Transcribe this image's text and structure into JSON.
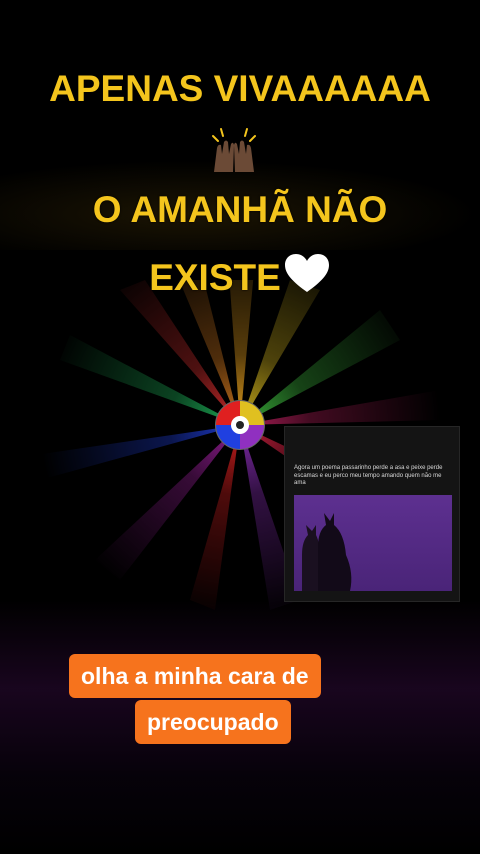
{
  "overlay": {
    "line1": "APENAS VIVAAAAAA",
    "line2": "O AMANHÃ NÃO",
    "line3": "EXISTE",
    "text_color": "#f4c51d"
  },
  "emoji": {
    "clap": "raising-hands-icon",
    "heart": "white-heart-icon"
  },
  "post": {
    "text": "Agora um poema passarinho perde a asa e peixe perde escamas e eu perco meu tempo amando quem não me ama"
  },
  "caption": {
    "line1": "olha a minha cara de",
    "line2": "preocupado",
    "pill_color": "#f6731d"
  }
}
